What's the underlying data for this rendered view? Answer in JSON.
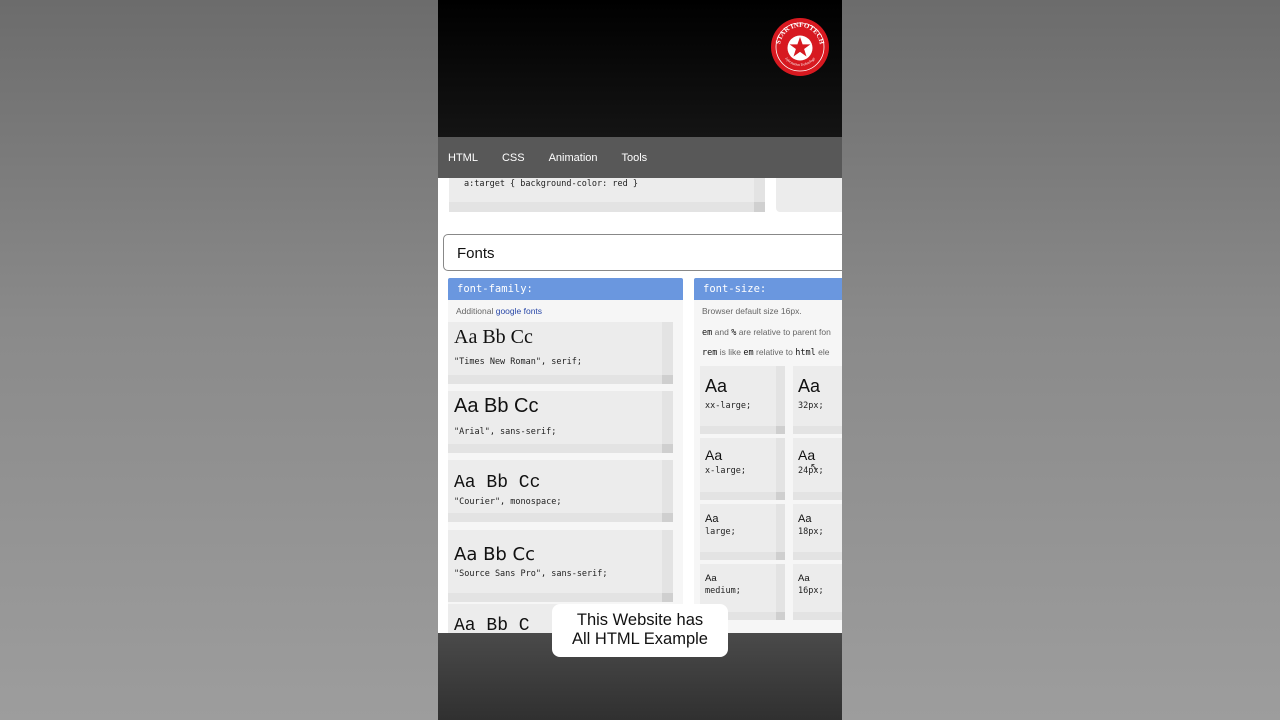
{
  "logo": {
    "text": "STAR INFOTECH",
    "tagline": "Information Technology",
    "accent": "#d71920"
  },
  "nav": {
    "items": [
      "HTML",
      "CSS",
      "Animation",
      "Tools"
    ]
  },
  "code_snippet": "a:target { background-color: red }",
  "section_title": "Fonts",
  "font_family": {
    "header": "font-family:",
    "note_prefix": "Additional",
    "note_link": "google fonts",
    "samples": [
      {
        "text": "Aa Bb Cc",
        "css": "\"Times New Roman\", serif;"
      },
      {
        "text": "Aa Bb Cc",
        "css": "\"Arial\", sans-serif;"
      },
      {
        "text": "Aa Bb Cc",
        "css": "\"Courier\", monospace;"
      },
      {
        "text": "Aa Bb Cc",
        "css": "\"Source Sans Pro\", sans-serif;"
      },
      {
        "text": "Aa Bb C"
      }
    ]
  },
  "font_size": {
    "header": "font-size:",
    "note1": "Browser default size 16px.",
    "note2_code1": "em",
    "note2_and": "and",
    "note2_code2": "%",
    "note2_rest": "are relative to parent fon",
    "note3_code1": "rem",
    "note3_mid": "is like",
    "note3_code2": "em",
    "note3_mid2": "relative to",
    "note3_code3": "html",
    "note3_rest": "ele",
    "rows": [
      {
        "a": {
          "sample": "Aa",
          "label": "xx-large;"
        },
        "b": {
          "sample": "Aa",
          "label": "32px;"
        }
      },
      {
        "a": {
          "sample": "Aa",
          "label": "x-large;"
        },
        "b": {
          "sample": "Aa",
          "label": "24px;"
        }
      },
      {
        "a": {
          "sample": "Aa",
          "label": "large;"
        },
        "b": {
          "sample": "Aa",
          "label": "18px;"
        }
      },
      {
        "a": {
          "sample": "Aa",
          "label": "medium;"
        },
        "b": {
          "sample": "Aa",
          "label": "16px;"
        }
      }
    ]
  },
  "caption": {
    "line1": "This Website has",
    "line2": "All HTML Example"
  },
  "colors": {
    "header_blue": "#6a97df",
    "nav_bg": "#585858",
    "panel_bg": "#ececec"
  }
}
